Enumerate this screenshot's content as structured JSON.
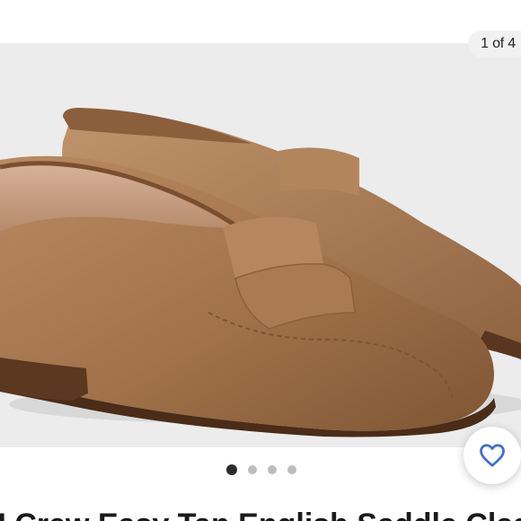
{
  "gallery": {
    "counter": "1 of 4",
    "image_alt": "Brown leather penny loafers",
    "dot_count": 4,
    "active_index": 0
  },
  "like": {
    "icon": "heart-outline-icon",
    "color": "#3b6fd6"
  },
  "product": {
    "title": "J.Crew Easy Tan English Saddle Classic"
  },
  "colors": {
    "gallery_bg": "#ececec",
    "leather": "#a0714a"
  }
}
